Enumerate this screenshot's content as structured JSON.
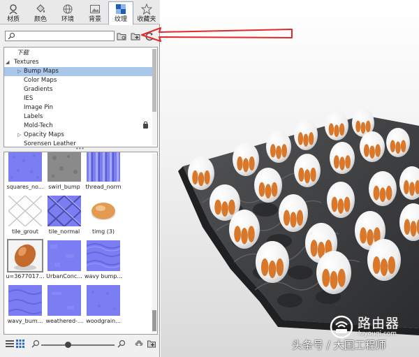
{
  "tabs": [
    {
      "label": "材质",
      "icon": "person-icon"
    },
    {
      "label": "颜色",
      "icon": "paint-bucket-icon"
    },
    {
      "label": "环境",
      "icon": "globe-icon"
    },
    {
      "label": "背景",
      "icon": "image-icon"
    },
    {
      "label": "纹理",
      "icon": "texture-icon",
      "active": true
    },
    {
      "label": "收藏夹",
      "icon": "star-icon"
    }
  ],
  "search": {
    "value": "",
    "placeholder": ""
  },
  "tree": {
    "header": "下载",
    "root": "Textures",
    "items": [
      {
        "label": "Bump Maps",
        "expandable": true,
        "selected": true
      },
      {
        "label": "Color Maps"
      },
      {
        "label": "Gradients"
      },
      {
        "label": "IES"
      },
      {
        "label": "Image Pin"
      },
      {
        "label": "Labels"
      },
      {
        "label": "Mold-Tech",
        "locked": true
      },
      {
        "label": "Opacity Maps",
        "expandable": true
      },
      {
        "label": "Sorensen Leather"
      }
    ]
  },
  "splitter_glyph": "•••",
  "thumbnails": [
    {
      "caption": "squares_no...",
      "kind": "blue-noise"
    },
    {
      "caption": "swirl_bump",
      "kind": "grey-noise"
    },
    {
      "caption": "thread_norm",
      "kind": "stripes"
    },
    {
      "caption": "tile_grout",
      "kind": "grout"
    },
    {
      "caption": "tile_normal",
      "kind": "diamond"
    },
    {
      "caption": "timg (3)",
      "kind": "egg-small"
    },
    {
      "caption": "u=3677017...",
      "kind": "egg-big",
      "selected": true
    },
    {
      "caption": "UrbanConc...",
      "kind": "blue-flat"
    },
    {
      "caption": "wavy bump...",
      "kind": "blue-wavy"
    },
    {
      "caption": "wavy_bum...",
      "kind": "blue-wavy"
    },
    {
      "caption": "weathered-...",
      "kind": "blue-flat"
    },
    {
      "caption": "woodgrain...",
      "kind": "blue-noise"
    }
  ],
  "colors": {
    "annotation_arrow": "#e5262a",
    "selection": "#a9c7ea",
    "normal_map_blue": "#7b7ef2",
    "egg_shell": "#f3f3f3",
    "egg_print": "#d9782a",
    "carton": "#3b3c3e"
  },
  "watermark": {
    "brand": "路由器",
    "domain": "luyouqi.com",
    "caption": "头条号 / 大国工程师"
  }
}
